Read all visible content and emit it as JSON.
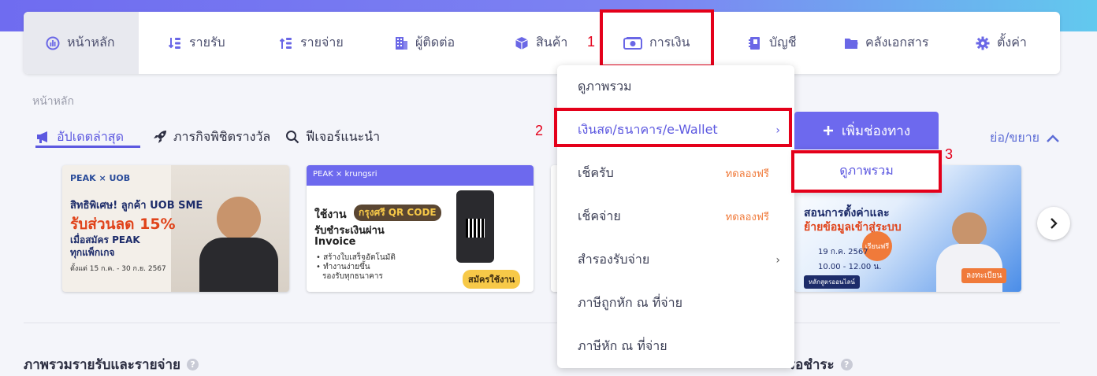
{
  "nav": {
    "items": [
      {
        "label": "หน้าหลัก",
        "icon": "dashboard-icon"
      },
      {
        "label": "รายรับ",
        "icon": "income-icon"
      },
      {
        "label": "รายจ่าย",
        "icon": "expense-icon"
      },
      {
        "label": "ผู้ติดต่อ",
        "icon": "contacts-icon"
      },
      {
        "label": "สินค้า",
        "icon": "product-box-icon"
      },
      {
        "label": "การเงิน",
        "icon": "money-icon"
      },
      {
        "label": "บัญชี",
        "icon": "ledger-book-icon"
      },
      {
        "label": "คลังเอกสาร",
        "icon": "folder-icon"
      },
      {
        "label": "ตั้งค่า",
        "icon": "gear-icon"
      }
    ]
  },
  "annotations": {
    "step1": "1",
    "step2": "2",
    "step3": "3"
  },
  "breadcrumb": "หน้าหลัก",
  "subtabs": {
    "updates": "อัปเดตล่าสุด",
    "awards": "ภารกิจพิชิตรางวัล",
    "features": "ฟีเจอร์แนะนำ"
  },
  "toggle_label": "ย่อ/ขยาย",
  "banners": {
    "uob": {
      "brand": "PEAK × UOB",
      "line1": "สิทธิพิเศษ! ลูกค้า UOB SME",
      "line2": "รับส่วนลด 15%",
      "line3": "เมื่อสมัคร PEAK",
      "line4": "ทุกแพ็กเกจ",
      "date": "ตั้งแต่ 15 ก.ค. - 30 ก.ย. 2567"
    },
    "krungsri": {
      "brand": "PEAK × krungsri",
      "line1": "ใช้งาน",
      "tag": "กรุงศรี QR CODE",
      "line2": "รับชำระเงินผ่าน",
      "line3": "Invoice",
      "bullet1": "• สร้างใบเสร็จอัตโนมัติ",
      "bullet2": "• ทำงานง่ายขึ้น",
      "bullet3": "รองรับทุกธนาคาร",
      "cta": "สมัครใช้งาน"
    },
    "webinar": {
      "line1": "สอนการตั้งค่าและ",
      "line2": "ย้ายข้อมูลเข้าสู่ระบบ",
      "date": "19 ก.ค. 2567",
      "time": "10.00 - 12.00 น.",
      "badge": "เรียนฟรี",
      "cta": "ลงทะเบียน",
      "tag": "หลักสูตรออนไลน์"
    }
  },
  "dropdown": {
    "items": [
      {
        "label": "ดูภาพรวม"
      },
      {
        "label": "เงินสด/ธนาคาร/e-Wallet",
        "chevron": "›"
      },
      {
        "label": "เช็ครับ",
        "trial": "ทดลองฟรี"
      },
      {
        "label": "เช็คจ่าย",
        "trial": "ทดลองฟรี"
      },
      {
        "label": "สำรองรับจ่าย",
        "chevron": "›"
      },
      {
        "label": "ภาษีถูกหัก ณ ที่จ่าย"
      },
      {
        "label": "ภาษีหัก ณ ที่จ่าย"
      }
    ]
  },
  "submenu": {
    "add_channel": "เพิ่มช่องทาง",
    "add_icon": "plus-icon",
    "overview": "ดูภาพรวม"
  },
  "sections": {
    "income_expense": "ภาพรวมรายรับและรายจ่าย",
    "awaiting": "รอชำระ"
  },
  "colors": {
    "accent": "#5c58e0",
    "highlight_red": "#e4001a",
    "trial_orange": "#f07a3a"
  }
}
